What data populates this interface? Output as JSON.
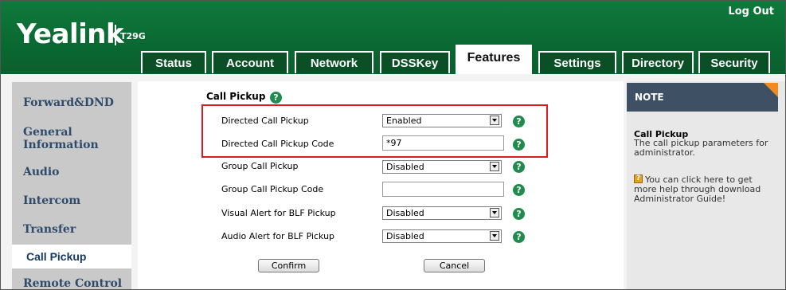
{
  "header": {
    "logo": "Yealink",
    "model": "T29G",
    "logout_label": "Log Out"
  },
  "tabs": [
    {
      "label": "Status"
    },
    {
      "label": "Account"
    },
    {
      "label": "Network"
    },
    {
      "label": "DSSKey"
    },
    {
      "label": "Features",
      "active": true
    },
    {
      "label": "Settings"
    },
    {
      "label": "Directory"
    },
    {
      "label": "Security"
    }
  ],
  "sidebar": {
    "items": [
      {
        "label": "Forward&DND"
      },
      {
        "label": "General Information"
      },
      {
        "label": "Audio"
      },
      {
        "label": "Intercom"
      },
      {
        "label": "Transfer"
      },
      {
        "label": "Call Pickup",
        "active": true
      },
      {
        "label": "Remote Control"
      }
    ]
  },
  "main": {
    "section_title": "Call Pickup",
    "fields": [
      {
        "label": "Directed Call Pickup",
        "type": "select",
        "value": "Enabled"
      },
      {
        "label": "Directed Call Pickup Code",
        "type": "input",
        "value": "*97"
      },
      {
        "label": "Group Call Pickup",
        "type": "select",
        "value": "Disabled"
      },
      {
        "label": "Group Call Pickup Code",
        "type": "input",
        "value": ""
      },
      {
        "label": "Visual Alert for BLF Pickup",
        "type": "select",
        "value": "Disabled"
      },
      {
        "label": "Audio Alert for BLF Pickup",
        "type": "select",
        "value": "Disabled"
      }
    ],
    "confirm_label": "Confirm",
    "cancel_label": "Cancel"
  },
  "note": {
    "heading": "NOTE",
    "title": "Call Pickup",
    "text": "The call pickup parameters for administrator.",
    "help_text": "You can click here to get more help through download Administrator Guide!"
  },
  "icons": {
    "help": "help-icon",
    "dropdown": "chevron-down-icon",
    "guide": "book-icon"
  },
  "colors": {
    "brand_green": "#0b6a32",
    "highlight_red": "#e0191e",
    "note_header": "#3e5164",
    "note_accent": "#f28a20",
    "help_green": "#1f8b4c"
  }
}
